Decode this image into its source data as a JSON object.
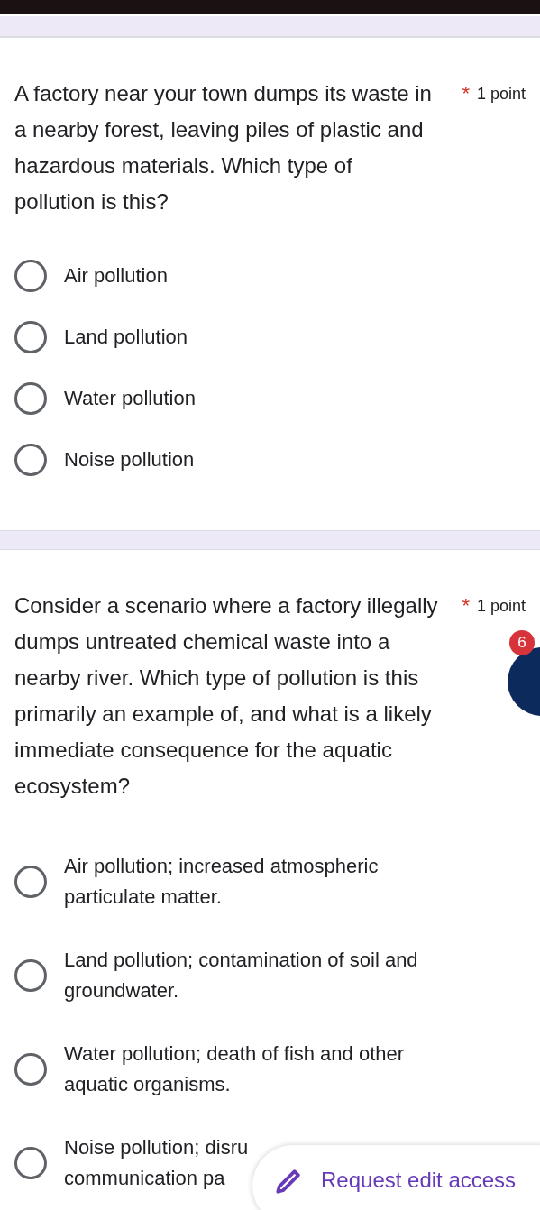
{
  "questions": [
    {
      "text": "A factory near your town dumps its waste in a nearby forest, leaving piles of plastic and hazardous materials. Which type of pollution is this?",
      "required_mark": "*",
      "points": "1 point",
      "options": [
        {
          "lines": [
            "Air pollution"
          ],
          "selected": false
        },
        {
          "lines": [
            "Land pollution"
          ],
          "selected": false
        },
        {
          "lines": [
            "Water pollution"
          ],
          "selected": false
        },
        {
          "lines": [
            "Noise pollution"
          ],
          "selected": false
        }
      ]
    },
    {
      "text": "Consider a scenario where a factory illegally dumps untreated chemical waste into a nearby river. Which type of pollution is this primarily an example of, and what is a likely immediate consequence for the aquatic ecosystem?",
      "required_mark": "*",
      "points": "1 point",
      "options": [
        {
          "lines": [
            "Air pollution; increased atmospheric",
            "particulate matter."
          ],
          "selected": false
        },
        {
          "lines": [
            "Land pollution; contamination of soil and",
            "groundwater."
          ],
          "selected": false
        },
        {
          "lines": [
            "Water pollution; death of fish and other",
            "aquatic organisms."
          ],
          "selected": false
        },
        {
          "lines": [
            "Noise pollution; disru",
            "communication pa"
          ],
          "selected": false
        }
      ]
    }
  ],
  "bubble": {
    "badge": "6"
  },
  "edit_button": {
    "label": "Request edit access"
  }
}
